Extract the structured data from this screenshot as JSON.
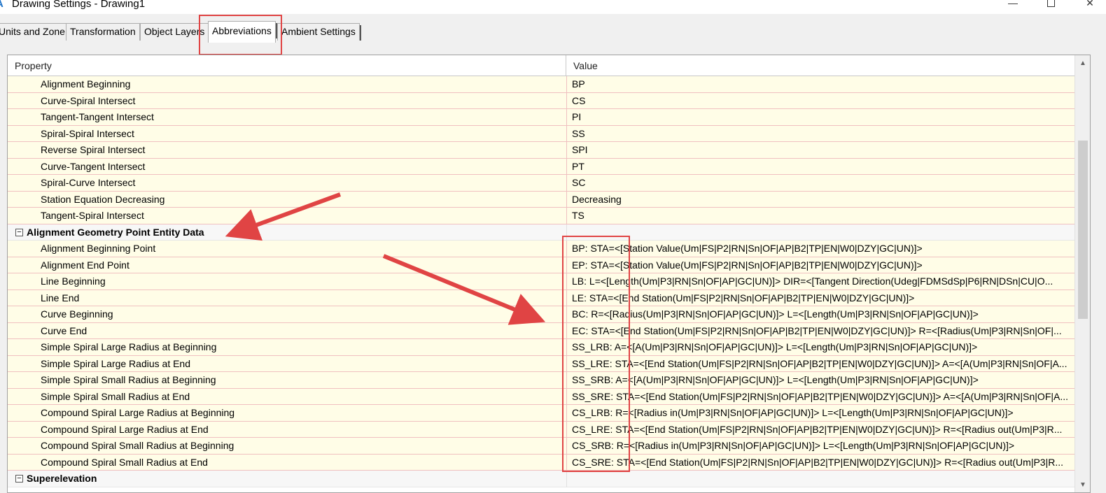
{
  "window": {
    "title": "Drawing Settings - Drawing1",
    "minimize_glyph": "—",
    "close_glyph": "✕"
  },
  "tabs": [
    {
      "label": "Units and Zone",
      "active": false
    },
    {
      "label": "Transformation",
      "active": false
    },
    {
      "label": "Object Layers",
      "active": false
    },
    {
      "label": "Abbreviations",
      "active": true
    },
    {
      "label": "Ambient Settings",
      "active": false
    }
  ],
  "grid": {
    "columns": {
      "property": "Property",
      "value": "Value"
    },
    "rows": [
      {
        "property": "Alignment Beginning",
        "value": "BP"
      },
      {
        "property": "Curve-Spiral Intersect",
        "value": "CS"
      },
      {
        "property": "Tangent-Tangent Intersect",
        "value": "PI"
      },
      {
        "property": "Spiral-Spiral Intersect",
        "value": "SS"
      },
      {
        "property": "Reverse Spiral Intersect",
        "value": "SPI"
      },
      {
        "property": "Curve-Tangent Intersect",
        "value": "PT"
      },
      {
        "property": "Spiral-Curve Intersect",
        "value": "SC"
      },
      {
        "property": "Station Equation Decreasing",
        "value": "Decreasing"
      },
      {
        "property": "Tangent-Spiral Intersect",
        "value": "TS"
      },
      {
        "property": "Alignment Geometry Point Entity Data",
        "value": "",
        "category": true,
        "expander": "−"
      },
      {
        "property": "Alignment Beginning Point",
        "value": "BP: STA=<[Station Value(Um|FS|P2|RN|Sn|OF|AP|B2|TP|EN|W0|DZY|GC|UN)]>"
      },
      {
        "property": "Alignment End Point",
        "value": "EP: STA=<[Station Value(Um|FS|P2|RN|Sn|OF|AP|B2|TP|EN|W0|DZY|GC|UN)]>"
      },
      {
        "property": "Line Beginning",
        "value": "LB: L=<[Length(Um|P3|RN|Sn|OF|AP|GC|UN)]> DIR=<[Tangent Direction(Udeg|FDMSdSp|P6|RN|DSn|CU|O..."
      },
      {
        "property": "Line End",
        "value": "LE: STA=<[End Station(Um|FS|P2|RN|Sn|OF|AP|B2|TP|EN|W0|DZY|GC|UN)]>"
      },
      {
        "property": "Curve Beginning",
        "value": "BC: R=<[Radius(Um|P3|RN|Sn|OF|AP|GC|UN)]> L=<[Length(Um|P3|RN|Sn|OF|AP|GC|UN)]>"
      },
      {
        "property": "Curve End",
        "value": "EC: STA=<[End Station(Um|FS|P2|RN|Sn|OF|AP|B2|TP|EN|W0|DZY|GC|UN)]> R=<[Radius(Um|P3|RN|Sn|OF|..."
      },
      {
        "property": "Simple Spiral Large Radius at Beginning",
        "value": "SS_LRB: A=<[A(Um|P3|RN|Sn|OF|AP|GC|UN)]> L=<[Length(Um|P3|RN|Sn|OF|AP|GC|UN)]>"
      },
      {
        "property": "Simple Spiral Large Radius at End",
        "value": "SS_LRE: STA=<[End Station(Um|FS|P2|RN|Sn|OF|AP|B2|TP|EN|W0|DZY|GC|UN)]> A=<[A(Um|P3|RN|Sn|OF|A..."
      },
      {
        "property": "Simple Spiral Small Radius at Beginning",
        "value": "SS_SRB: A=<[A(Um|P3|RN|Sn|OF|AP|GC|UN)]> L=<[Length(Um|P3|RN|Sn|OF|AP|GC|UN)]>"
      },
      {
        "property": "Simple Spiral Small Radius at End",
        "value": "SS_SRE: STA=<[End Station(Um|FS|P2|RN|Sn|OF|AP|B2|TP|EN|W0|DZY|GC|UN)]> A=<[A(Um|P3|RN|Sn|OF|A..."
      },
      {
        "property": "Compound Spiral Large Radius at Beginning",
        "value": "CS_LRB: R=<[Radius in(Um|P3|RN|Sn|OF|AP|GC|UN)]> L=<[Length(Um|P3|RN|Sn|OF|AP|GC|UN)]>"
      },
      {
        "property": "Compound Spiral Large Radius at End",
        "value": "CS_LRE: STA=<[End Station(Um|FS|P2|RN|Sn|OF|AP|B2|TP|EN|W0|DZY|GC|UN)]> R=<[Radius out(Um|P3|R..."
      },
      {
        "property": "Compound Spiral Small Radius at Beginning",
        "value": "CS_SRB: R=<[Radius in(Um|P3|RN|Sn|OF|AP|GC|UN)]> L=<[Length(Um|P3|RN|Sn|OF|AP|GC|UN)]>"
      },
      {
        "property": "Compound Spiral Small Radius at End",
        "value": "CS_SRE: STA=<[End Station(Um|FS|P2|RN|Sn|OF|AP|B2|TP|EN|W0|DZY|GC|UN)]> R=<[Radius out(Um|P3|R..."
      },
      {
        "property": "Superelevation",
        "value": "",
        "category": true,
        "expander": "−"
      }
    ]
  },
  "colors": {
    "row_background": "#fffde7",
    "grid_line": "#f0c0c0",
    "annotation_red": "#e04444"
  },
  "icons": {
    "app": "civil3d-logo-icon",
    "expander": "collapse-minus-icon",
    "scroll_up": "scroll-up-arrow-icon",
    "scroll_down": "scroll-down-arrow-icon"
  }
}
